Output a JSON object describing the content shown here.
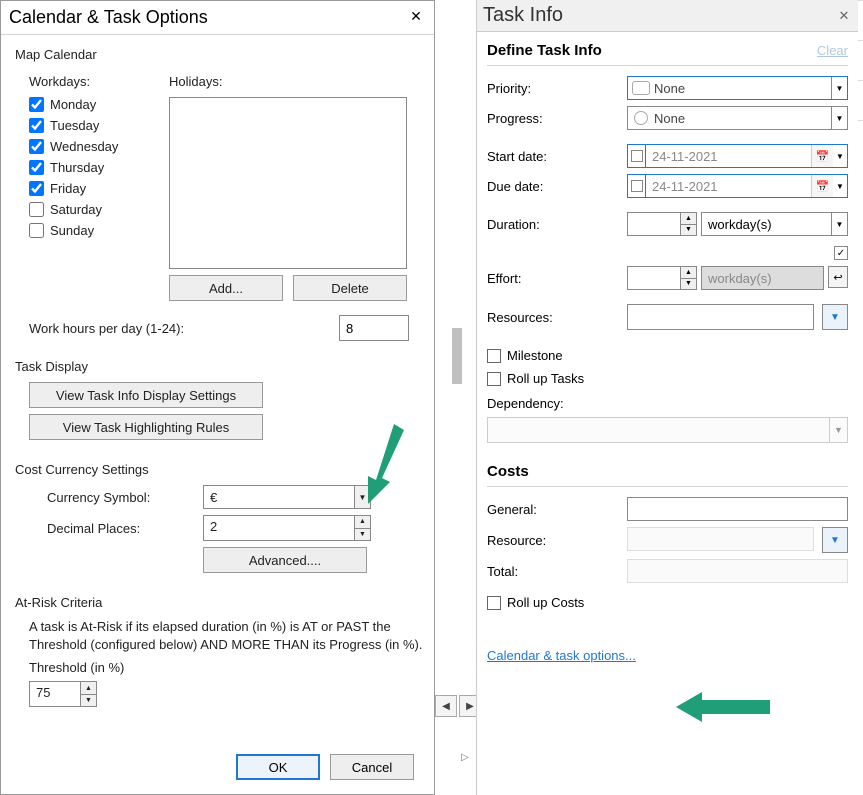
{
  "dialog": {
    "title": "Calendar & Task Options",
    "map_calendar_label": "Map Calendar",
    "workdays_label": "Workdays:",
    "holidays_label": "Holidays:",
    "days": [
      {
        "label": "Monday",
        "checked": true
      },
      {
        "label": "Tuesday",
        "checked": true
      },
      {
        "label": "Wednesday",
        "checked": true
      },
      {
        "label": "Thursday",
        "checked": true
      },
      {
        "label": "Friday",
        "checked": true
      },
      {
        "label": "Saturday",
        "checked": false
      },
      {
        "label": "Sunday",
        "checked": false
      }
    ],
    "add_btn": "Add...",
    "delete_btn": "Delete",
    "work_hours_label": "Work hours per day (1-24):",
    "work_hours_value": "8",
    "task_display_label": "Task Display",
    "view_task_info_btn": "View Task Info Display Settings",
    "view_highlight_btn": "View Task Highlighting Rules",
    "cost_currency_label": "Cost Currency Settings",
    "currency_symbol_label": "Currency Symbol:",
    "currency_symbol_value": "€",
    "decimal_places_label": "Decimal Places:",
    "decimal_places_value": "2",
    "advanced_btn": "Advanced....",
    "atrisk_label": "At-Risk Criteria",
    "atrisk_desc": "A task is At-Risk if its elapsed duration (in %) is AT or PAST the Threshold (configured below) AND MORE THAN its Progress (in %).",
    "threshold_label": "Threshold (in %)",
    "threshold_value": "75",
    "ok_btn": "OK",
    "cancel_btn": "Cancel"
  },
  "panel": {
    "title": "Task Info",
    "define_title": "Define Task Info",
    "clear_label": "Clear",
    "priority_label": "Priority:",
    "priority_value": "None",
    "progress_label": "Progress:",
    "progress_value": "None",
    "start_date_label": "Start date:",
    "start_date_value": "24-11-2021",
    "due_date_label": "Due date:",
    "due_date_value": "24-11-2021",
    "duration_label": "Duration:",
    "duration_unit": "workday(s)",
    "effort_label": "Effort:",
    "effort_unit": "workday(s)",
    "resources_label": "Resources:",
    "milestone_label": "Milestone",
    "rollup_tasks_label": "Roll up Tasks",
    "dependency_label": "Dependency:",
    "costs_label": "Costs",
    "general_label": "General:",
    "resource_label": "Resource:",
    "total_label": "Total:",
    "rollup_costs_label": "Roll up Costs",
    "calendar_link": "Calendar & task options..."
  }
}
